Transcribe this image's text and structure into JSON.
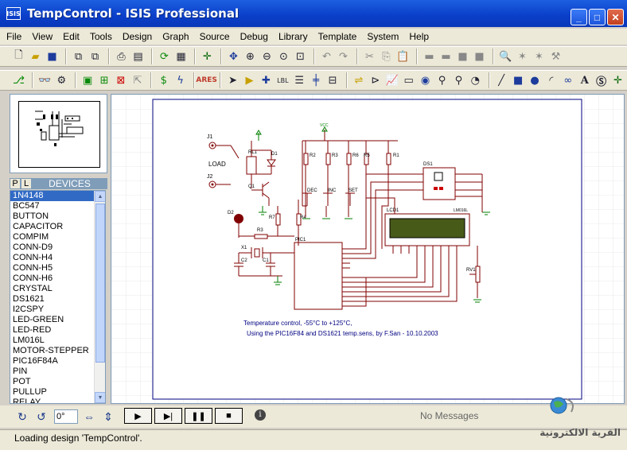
{
  "window": {
    "title": "TempControl - ISIS Professional",
    "app_icon": "ISIS"
  },
  "menu": [
    "File",
    "View",
    "Edit",
    "Tools",
    "Design",
    "Graph",
    "Source",
    "Debug",
    "Library",
    "Template",
    "System",
    "Help"
  ],
  "panel": {
    "tab_p": "P",
    "tab_l": "L",
    "title": "DEVICES"
  },
  "devices": [
    "1N4148",
    "BC547",
    "BUTTON",
    "CAPACITOR",
    "COMPIM",
    "CONN-D9",
    "CONN-H4",
    "CONN-H5",
    "CONN-H6",
    "CRYSTAL",
    "DS1621",
    "I2CSPY",
    "LED-GREEN",
    "LED-RED",
    "LM016L",
    "MOTOR-STEPPER",
    "PIC16F84A",
    "PIN",
    "POT",
    "PULLUP",
    "RELAY"
  ],
  "selected_device_index": 0,
  "schematic": {
    "labels": {
      "j1": "J1",
      "j2": "J2",
      "load": "LOAD",
      "rl1": "RL1",
      "d1": "D1",
      "q1": "Q1",
      "d2": "D2",
      "r1": "R1",
      "r2": "R2",
      "r3": "R3",
      "r4": "R4",
      "r5": "R5",
      "r6": "R6",
      "r7": "R7",
      "ds1": "DS1",
      "lcd1": "LCD1",
      "pic1": "PIC1",
      "rv1": "RV1",
      "x1": "X1",
      "c1": "C1",
      "c2": "C2",
      "dec": "DEC",
      "inc": "INC",
      "set": "SET",
      "vcc": "VCC",
      "lm016l": "LM016L"
    },
    "caption_line1": "Temperature control, -55°C to +125°C,",
    "caption_line2": "Using the PIC16F84 and DS1621 temp.sens,  by F.San - 10.10.2003"
  },
  "bottom": {
    "angle": "0°",
    "message": "No Messages"
  },
  "status": {
    "text": "Loading design 'TempControl'."
  },
  "watermark": {
    "text": "القرية الالكترونية"
  },
  "colors": {
    "title_blue": "#0a3ec9",
    "wire": "#800000",
    "component": "#00007f",
    "power": "#007f00",
    "sheet_border": "#000080"
  }
}
